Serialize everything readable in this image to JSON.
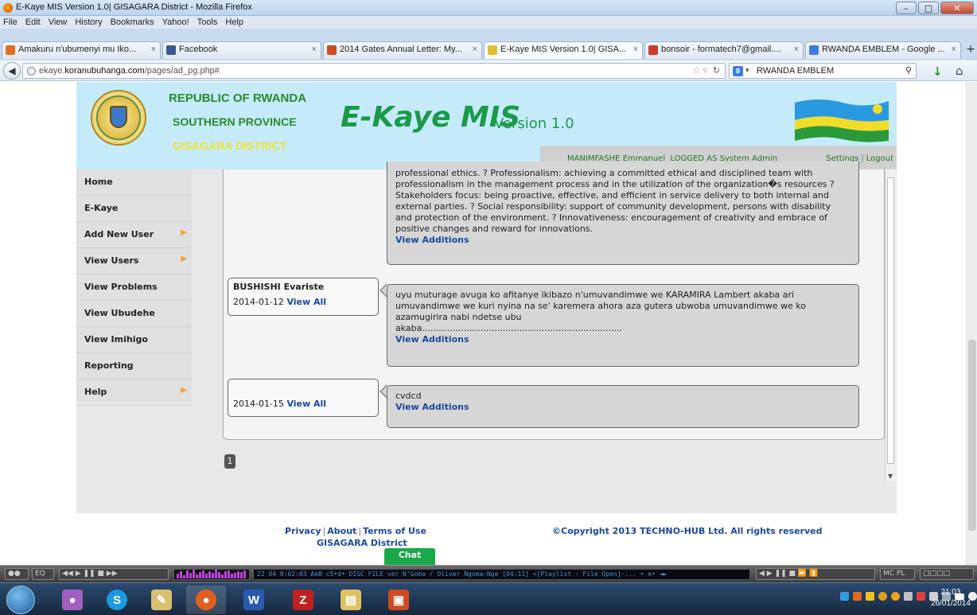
{
  "browser": {
    "window_title": "E-Kaye MIS Version 1.0| GISAGARA District - Mozilla Firefox",
    "menu": [
      "File",
      "Edit",
      "View",
      "History",
      "Bookmarks",
      "Yahoo!",
      "Tools",
      "Help"
    ],
    "tabs": [
      {
        "label": "Amakuru n'ubumenyi mu Iko...",
        "icon_color": "#e07020"
      },
      {
        "label": "Facebook",
        "icon_color": "#3b5998"
      },
      {
        "label": "2014 Gates Annual Letter: My...",
        "icon_color": "#d04a20"
      },
      {
        "label": "E-Kaye MIS Version 1.0| GISA...",
        "icon_color": "#e0c030"
      },
      {
        "label": "bonsoir - formatech7@gmail....",
        "icon_color": "#d03a2a"
      },
      {
        "label": "RWANDA EMBLEM - Google ...",
        "icon_color": "#3b7be8"
      }
    ],
    "url_prefix": "ekaye.",
    "url_domain": "koranubuhanga.com",
    "url_path": "/pages/ad_pg.php#",
    "search_value": "RWANDA EMBLEM",
    "search_engine_letter": "8"
  },
  "header": {
    "republic": "REPUBLIC OF RWANDA",
    "province": "SOUTHERN PROVINCE",
    "district": "GISAGARA DISTRICT",
    "app_name": "E-Kaye MIS",
    "version": "Version 1.0",
    "user_name": "MANIMFASHE Emmanuel",
    "logged_as": "LOGGED AS System Admin",
    "settings": "Settings",
    "logout": "Logout"
  },
  "sidebar": {
    "items": [
      {
        "label": "Home",
        "has_submenu": false
      },
      {
        "label": "E-Kaye",
        "has_submenu": false
      },
      {
        "label": "Add New User",
        "has_submenu": true
      },
      {
        "label": "View Users",
        "has_submenu": true
      },
      {
        "label": "View Problems",
        "has_submenu": false
      },
      {
        "label": "View Ubudehe",
        "has_submenu": false
      },
      {
        "label": "View Imihigo",
        "has_submenu": false
      },
      {
        "label": "Reporting",
        "has_submenu": false
      },
      {
        "label": "Help",
        "has_submenu": true
      }
    ]
  },
  "posts": {
    "first_body_lines": [
      "professional ethics. ? Professionalism: achieving a committed ethical and disciplined team with",
      "professionalism in the management process and in the utilization of the organization�s resources ?",
      "Stakeholders focus: being proactive, effective, and efficient in service delivery to both internal and",
      "external parties. ? Social responsibility: support of community development, persons with disability",
      "and protection of the environment. ? Innovativeness: encouragement of creativity and embrace of",
      "positive changes and reward for innovations."
    ],
    "view_additions": "View Additions",
    "view_all": "View All",
    "second": {
      "author": "BUSHISHI  Evariste",
      "date": "2014-01-12",
      "body_lines": [
        "uyu muturage avuga ko afitanye ikibazo n'umuvandimwe we KARAMIRA Lambert akaba ari",
        "umuvandimwe we kuri nyina na se' karemera ahora aza gutera ubwoba umuvandimwe we ko",
        "azamugirira nabi ndetse ubu",
        "akaba........................................................................"
      ]
    },
    "third": {
      "author": "",
      "date": "2014-01-15",
      "body_lines": [
        "cvdcd"
      ]
    }
  },
  "pager": {
    "current": "1"
  },
  "footer": {
    "privacy": "Privacy",
    "about": "About",
    "terms": "Terms of Use",
    "district": "GISAGARA District",
    "copyright": "©Copyright 2013 TECHNO-HUB Ltd. All rights reserved",
    "chat": "Chat"
  },
  "media_player": {
    "track_text": "22  04  0:02:03  A⊕B c5•d• DISC FILE  ver N'Goma / Oliver Ngoma-Nge [04:11]   <[Playlist - File Open]-... • ⊕• ◄►"
  },
  "taskbar": {
    "time": "21:03",
    "date": "26/01/2014"
  }
}
